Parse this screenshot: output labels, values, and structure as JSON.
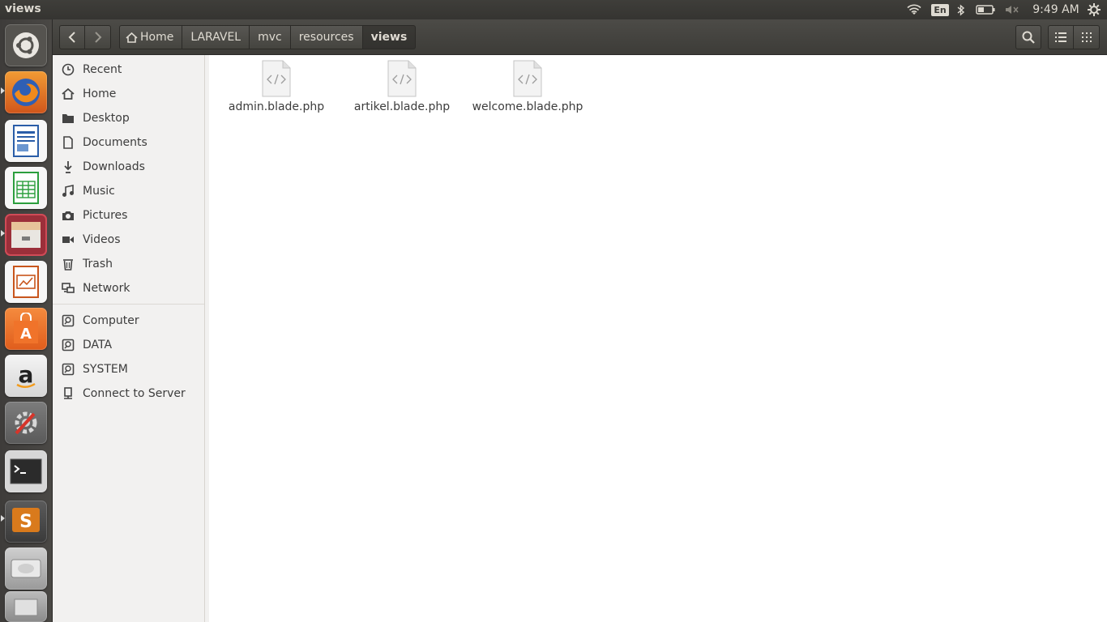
{
  "panel": {
    "window_title": "views",
    "language": "En",
    "clock": "9:49 AM",
    "icons": [
      "wifi-icon",
      "bluetooth-icon",
      "battery-icon",
      "volume-muted-icon",
      "session-gear-icon"
    ]
  },
  "launcher": {
    "items": [
      {
        "name": "ubuntu-dash",
        "color": "#5a5855"
      },
      {
        "name": "firefox",
        "color": "#e8731c"
      },
      {
        "name": "libreoffice-writer",
        "color": "#2a5da8"
      },
      {
        "name": "libreoffice-calc",
        "color": "#2b9e3d"
      },
      {
        "name": "files",
        "color": "#b33b46"
      },
      {
        "name": "libreoffice-impress",
        "color": "#c8551c"
      },
      {
        "name": "ubuntu-software",
        "color": "#ef7a32"
      },
      {
        "name": "amazon",
        "color": "#cfcfcf"
      },
      {
        "name": "system-settings",
        "color": "#6b6b6b"
      },
      {
        "name": "terminal",
        "color": "#2b2b2b"
      },
      {
        "name": "sublime-text",
        "color": "#d97a1c"
      },
      {
        "name": "disk",
        "color": "#8f8f8f"
      },
      {
        "name": "trash",
        "color": "#7a7a7a"
      }
    ]
  },
  "header": {
    "breadcrumbs": [
      "Home",
      "LARAVEL",
      "mvc",
      "resources",
      "views"
    ]
  },
  "sidebar": {
    "places": [
      {
        "label": "Recent",
        "icon": "clock-icon"
      },
      {
        "label": "Home",
        "icon": "home-icon"
      },
      {
        "label": "Desktop",
        "icon": "folder-icon"
      },
      {
        "label": "Documents",
        "icon": "document-icon"
      },
      {
        "label": "Downloads",
        "icon": "download-icon"
      },
      {
        "label": "Music",
        "icon": "music-icon"
      },
      {
        "label": "Pictures",
        "icon": "camera-icon"
      },
      {
        "label": "Videos",
        "icon": "video-icon"
      },
      {
        "label": "Trash",
        "icon": "trash-icon"
      },
      {
        "label": "Network",
        "icon": "network-icon"
      }
    ],
    "devices": [
      {
        "label": "Computer",
        "icon": "drive-icon"
      },
      {
        "label": "DATA",
        "icon": "drive-icon"
      },
      {
        "label": "SYSTEM",
        "icon": "drive-icon"
      },
      {
        "label": "Connect to Server",
        "icon": "server-icon"
      }
    ]
  },
  "files": [
    {
      "name": "admin.blade.php",
      "icon": "code-file-icon"
    },
    {
      "name": "artikel.blade.php",
      "icon": "code-file-icon"
    },
    {
      "name": "welcome.blade.php",
      "icon": "code-file-icon"
    }
  ]
}
